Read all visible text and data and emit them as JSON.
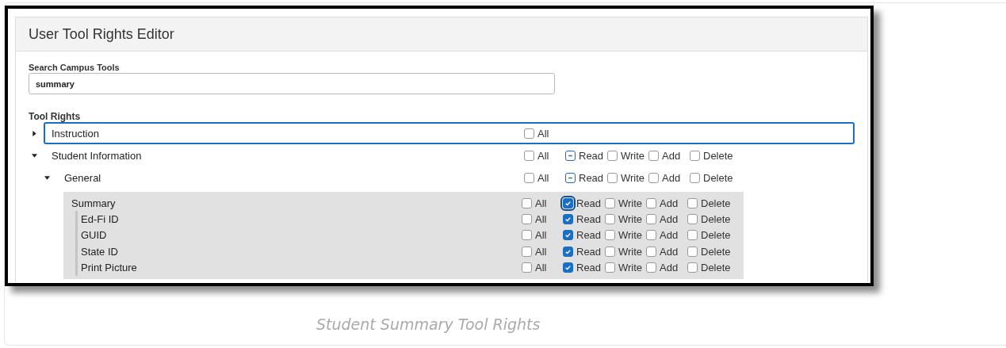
{
  "editor": {
    "title": "User Tool Rights Editor",
    "search": {
      "label": "Search Campus Tools",
      "value": "summary"
    },
    "section_label": "Tool Rights",
    "tools": [
      {
        "label": "Instruction",
        "expanded": false,
        "focused": true,
        "rights": [
          {
            "label": "All",
            "checked": false
          }
        ]
      },
      {
        "label": "Student Information",
        "expanded": true,
        "rights": [
          {
            "label": "All",
            "checked": false
          },
          {
            "label": "Read",
            "indeterminate": true
          },
          {
            "label": "Write",
            "checked": false
          },
          {
            "label": "Add",
            "checked": false
          },
          {
            "label": "Delete",
            "checked": false
          }
        ],
        "children": [
          {
            "label": "General",
            "expanded": true,
            "rights": [
              {
                "label": "All",
                "checked": false
              },
              {
                "label": "Read",
                "indeterminate": true
              },
              {
                "label": "Write",
                "checked": false
              },
              {
                "label": "Add",
                "checked": false
              },
              {
                "label": "Delete",
                "checked": false
              }
            ],
            "children": [
              {
                "label": "Summary",
                "rights": [
                  {
                    "label": "All",
                    "checked": false
                  },
                  {
                    "label": "Read",
                    "checked": true,
                    "focused": true
                  },
                  {
                    "label": "Write",
                    "checked": false
                  },
                  {
                    "label": "Add",
                    "checked": false
                  },
                  {
                    "label": "Delete",
                    "checked": false
                  }
                ],
                "children": [
                  {
                    "label": "Ed-Fi ID",
                    "rights": [
                      {
                        "label": "All",
                        "checked": false
                      },
                      {
                        "label": "Read",
                        "checked": true
                      },
                      {
                        "label": "Write",
                        "checked": false
                      },
                      {
                        "label": "Add",
                        "checked": false
                      },
                      {
                        "label": "Delete",
                        "checked": false
                      }
                    ]
                  },
                  {
                    "label": "GUID",
                    "rights": [
                      {
                        "label": "All",
                        "checked": false
                      },
                      {
                        "label": "Read",
                        "checked": true
                      },
                      {
                        "label": "Write",
                        "checked": false
                      },
                      {
                        "label": "Add",
                        "checked": false
                      },
                      {
                        "label": "Delete",
                        "checked": false
                      }
                    ]
                  },
                  {
                    "label": "State ID",
                    "rights": [
                      {
                        "label": "All",
                        "checked": false
                      },
                      {
                        "label": "Read",
                        "checked": true
                      },
                      {
                        "label": "Write",
                        "checked": false
                      },
                      {
                        "label": "Add",
                        "checked": false
                      },
                      {
                        "label": "Delete",
                        "checked": false
                      }
                    ]
                  },
                  {
                    "label": "Print Picture",
                    "rights": [
                      {
                        "label": "All",
                        "checked": false
                      },
                      {
                        "label": "Read",
                        "checked": true
                      },
                      {
                        "label": "Write",
                        "checked": false
                      },
                      {
                        "label": "Add",
                        "checked": false
                      },
                      {
                        "label": "Delete",
                        "checked": false
                      }
                    ]
                  }
                ]
              }
            ]
          }
        ]
      }
    ]
  },
  "caption": "Student Summary Tool Rights"
}
